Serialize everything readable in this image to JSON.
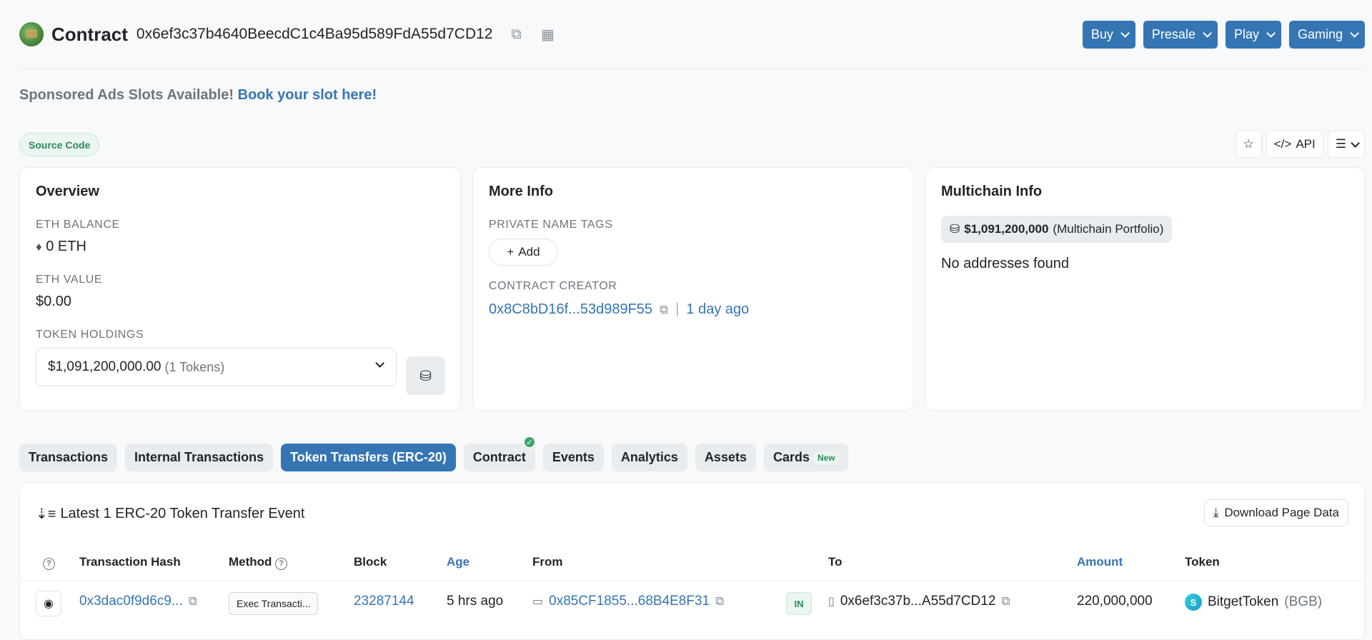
{
  "header": {
    "title": "Contract",
    "address": "0x6ef3c37b4640BeecdC1c4Ba95d589FdA55d7CD12",
    "buttons": [
      "Buy",
      "Presale",
      "Play",
      "Gaming"
    ],
    "accent": "#3575b3"
  },
  "sponsored": {
    "text": "Sponsored Ads Slots Available!",
    "link": "Book your slot here!"
  },
  "source_badge": "Source Code",
  "tools": {
    "api": "API"
  },
  "overview": {
    "title": "Overview",
    "eth_balance_label": "ETH BALANCE",
    "eth_balance": "0 ETH",
    "eth_value_label": "ETH VALUE",
    "eth_value": "$0.00",
    "token_holdings_label": "TOKEN HOLDINGS",
    "token_holdings_value": "$1,091,200,000.00",
    "token_holdings_count": "(1 Tokens)"
  },
  "more_info": {
    "title": "More Info",
    "private_tags_label": "PRIVATE NAME TAGS",
    "add_label": "Add",
    "creator_label": "CONTRACT CREATOR",
    "creator_address": "0x8C8bD16f...53d989F55",
    "creator_age": "1 day ago"
  },
  "multichain": {
    "title": "Multichain Info",
    "portfolio_value": "$1,091,200,000",
    "portfolio_label": "(Multichain Portfolio)",
    "empty": "No addresses found"
  },
  "tabs": [
    {
      "label": "Transactions"
    },
    {
      "label": "Internal Transactions"
    },
    {
      "label": "Token Transfers (ERC-20)"
    },
    {
      "label": "Contract"
    },
    {
      "label": "Events"
    },
    {
      "label": "Analytics"
    },
    {
      "label": "Assets"
    },
    {
      "label": "Cards"
    }
  ],
  "new_badge": "New",
  "transfers": {
    "title": "Latest 1 ERC-20 Token Transfer Event",
    "download": "Download Page Data",
    "columns": [
      "Transaction Hash",
      "Method",
      "Block",
      "Age",
      "From",
      "To",
      "Amount",
      "Token"
    ],
    "row": {
      "hash": "0x3dac0f9d6c9...",
      "method": "Exec Transacti...",
      "block": "23287144",
      "age": "5 hrs ago",
      "from": "0x85CF1855...68B4E8F31",
      "direction": "IN",
      "to": "0x6ef3c37b...A55d7CD12",
      "amount": "220,000,000",
      "token_name": "BitgetToken",
      "token_symbol": "(BGB)"
    }
  }
}
